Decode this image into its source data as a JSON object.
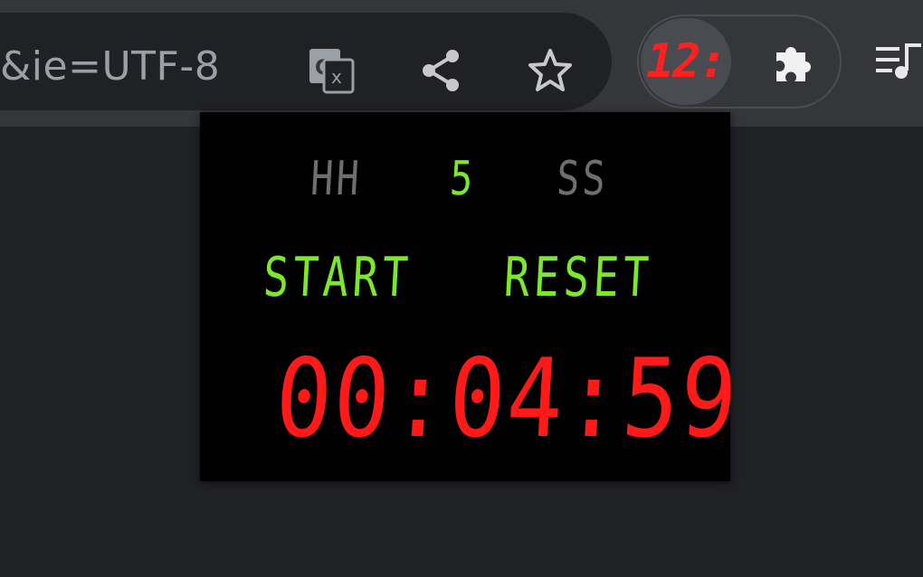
{
  "toolbar": {
    "url_fragment": "&ie=UTF-8",
    "icons": {
      "translate": "translate-icon",
      "share": "share-icon",
      "bookmark": "star-icon",
      "timer_extension": "timer-extension-icon",
      "extensions": "puzzle-icon",
      "media": "media-queue-icon"
    },
    "timer_badge": "12:"
  },
  "popup": {
    "fields": {
      "hours": "HH",
      "minutes": "5",
      "seconds": "SS"
    },
    "start_label": "START",
    "reset_label": "RESET",
    "countdown": "00:04:59"
  },
  "colors": {
    "toolbar_bg": "#35363a",
    "page_bg": "#202124",
    "popup_bg": "#000000",
    "segment_green": "#7be82a",
    "segment_red": "#ff1a1a",
    "placeholder_gray": "#6e6e6e"
  }
}
